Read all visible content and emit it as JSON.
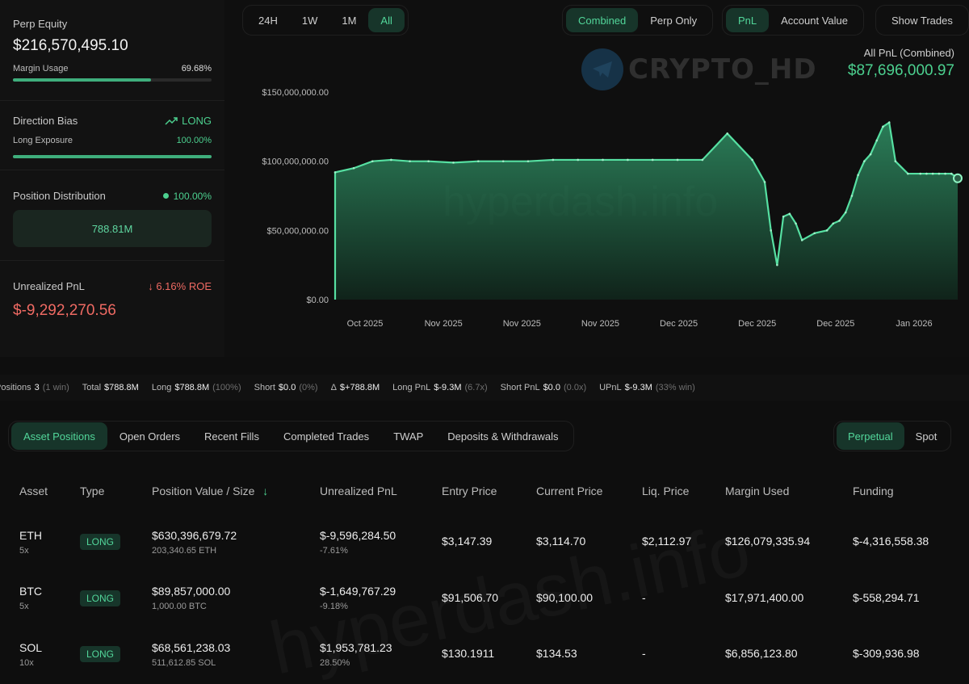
{
  "left": {
    "perp_equity_label": "Perp Equity",
    "perp_equity_value": "$216,570,495.10",
    "margin_usage_label": "Margin Usage",
    "margin_usage_value": "69.68%",
    "margin_usage_fraction": 0.6968,
    "direction_bias_label": "Direction Bias",
    "direction_bias_value": "LONG",
    "long_exposure_label": "Long Exposure",
    "long_exposure_value": "100.00%",
    "long_exposure_fraction": 1.0,
    "position_distribution_label": "Position Distribution",
    "position_distribution_value": "100.00%",
    "position_distribution_amount": "788.81M",
    "unrealized_pnl_label": "Unrealized PnL",
    "unrealized_pnl_roe": "6.16% ROE",
    "unrealized_pnl_value": "$-9,292,270.56"
  },
  "timeframes": [
    "24H",
    "1W",
    "1M",
    "All"
  ],
  "timeframe_active": "All",
  "view_modes": [
    "Combined",
    "Perp Only"
  ],
  "metric_modes": [
    "PnL",
    "Account Value"
  ],
  "show_trades_label": "Show Trades",
  "watermark": {
    "brand": "CRYPTO_HD",
    "site": "hyperdash.info"
  },
  "pnl_header": {
    "title": "All PnL (Combined)",
    "value": "$87,696,000.97"
  },
  "colors": {
    "accent": "#4cd08f",
    "negative": "#ef6a63",
    "active_bg": "#17352a"
  },
  "chart_data": {
    "type": "area",
    "yticks": [
      "$150,000,000.00",
      "$100,000,000.00",
      "$50,000,000.00",
      "$0.00"
    ],
    "ylim": [
      0,
      150000000
    ],
    "xticks": [
      "Oct 2025",
      "Nov 2025",
      "Nov 2025",
      "Nov 2025",
      "Dec 2025",
      "Dec 2025",
      "Dec 2025",
      "Jan 2026"
    ],
    "x": [
      0,
      3,
      6,
      9,
      12,
      15,
      19,
      23,
      27,
      31,
      35,
      39,
      43,
      47,
      51,
      55,
      59,
      63,
      67,
      69,
      70,
      71,
      72,
      73,
      74,
      75,
      77,
      79,
      80,
      81,
      82,
      83,
      84,
      85,
      86,
      87,
      88,
      89,
      90,
      92,
      94,
      95,
      96,
      97,
      98,
      99,
      100
    ],
    "values": [
      92000000,
      95000000,
      100000000,
      101000000,
      100000000,
      100000000,
      99000000,
      100000000,
      100000000,
      100000000,
      101000000,
      101000000,
      101000000,
      101000000,
      101000000,
      101000000,
      101000000,
      120000000,
      101000000,
      85000000,
      50000000,
      25000000,
      60000000,
      62000000,
      55000000,
      43000000,
      48000000,
      50000000,
      55000000,
      57000000,
      63000000,
      75000000,
      90000000,
      100000000,
      105000000,
      115000000,
      125000000,
      128000000,
      100000000,
      91000000,
      91000000,
      91000000,
      91000000,
      91000000,
      91000000,
      91000000,
      87696000
    ]
  },
  "stats": {
    "positions_label": "Positions",
    "positions_value": "3",
    "positions_note": "(1 win)",
    "total_label": "Total",
    "total_value": "$788.8M",
    "long_label": "Long",
    "long_value": "$788.8M",
    "long_note": "(100%)",
    "short_label": "Short",
    "short_value": "$0.0",
    "short_note": "(0%)",
    "delta_label": "Δ",
    "delta_value": "$+788.8M",
    "long_pnl_label": "Long PnL",
    "long_pnl_value": "$-9.3M",
    "long_pnl_note": "(6.7x)",
    "short_pnl_label": "Short PnL",
    "short_pnl_value": "$0.0",
    "short_pnl_note": "(0.0x)",
    "upnl_label": "UPnL",
    "upnl_value": "$-9.3M",
    "upnl_note": "(33% win)"
  },
  "tabs": [
    "Asset Positions",
    "Open Orders",
    "Recent Fills",
    "Completed Trades",
    "TWAP",
    "Deposits & Withdrawals"
  ],
  "market_tabs": [
    "Perpetual",
    "Spot"
  ],
  "table": {
    "headers": [
      "Asset",
      "Type",
      "Position Value / Size",
      "Unrealized PnL",
      "Entry Price",
      "Current Price",
      "Liq. Price",
      "Margin Used",
      "Funding"
    ],
    "sort_indicator": "↓",
    "rows": [
      {
        "asset": "ETH",
        "leverage": "5x",
        "type": "LONG",
        "value": "$630,396,679.72",
        "size": "203,340.65 ETH",
        "pnl": "$-9,596,284.50",
        "pnl_pct": "-7.61%",
        "entry": "$3,147.39",
        "current": "$3,114.70",
        "liq": "$2,112.97",
        "margin": "$126,079,335.94",
        "funding": "$-4,316,558.38"
      },
      {
        "asset": "BTC",
        "leverage": "5x",
        "type": "LONG",
        "value": "$89,857,000.00",
        "size": "1,000.00 BTC",
        "pnl": "$-1,649,767.29",
        "pnl_pct": "-9.18%",
        "entry": "$91,506.70",
        "current": "$90,100.00",
        "liq": "-",
        "margin": "$17,971,400.00",
        "funding": "$-558,294.71"
      },
      {
        "asset": "SOL",
        "leverage": "10x",
        "type": "LONG",
        "value": "$68,561,238.03",
        "size": "511,612.85 SOL",
        "pnl": "$1,953,781.23",
        "pnl_pct": "28.50%",
        "entry": "$130.1911",
        "current": "$134.53",
        "liq": "-",
        "margin": "$6,856,123.80",
        "funding": "$-309,936.98"
      }
    ]
  }
}
